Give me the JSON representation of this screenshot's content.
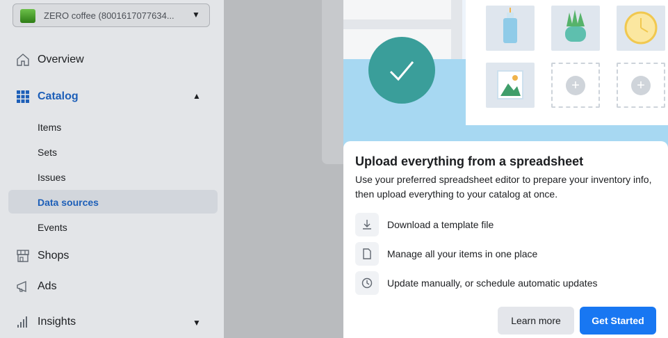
{
  "sidebar": {
    "account": {
      "name": "ZERO coffee (8001617077634...",
      "caret": "▼"
    },
    "overview": {
      "label": "Overview",
      "icon": "home-icon"
    },
    "catalog": {
      "label": "Catalog",
      "icon": "grid-icon",
      "chevron": "▲"
    },
    "catalog_items": [
      {
        "label": "Items"
      },
      {
        "label": "Sets"
      },
      {
        "label": "Issues"
      },
      {
        "label": "Data sources",
        "active": true
      },
      {
        "label": "Events"
      }
    ],
    "shops": {
      "label": "Shops",
      "icon": "store-icon"
    },
    "ads": {
      "label": "Ads",
      "icon": "megaphone-icon"
    },
    "insights": {
      "label": "Insights",
      "icon": "bar-chart-icon",
      "chevron": "▼"
    }
  },
  "modal": {
    "title": "Upload everything from a spreadsheet",
    "description": "Use your preferred spreadsheet editor to prepare your inventory info, then upload everything to your catalog at once.",
    "features": [
      {
        "label": "Download a template file",
        "icon": "download-icon"
      },
      {
        "label": "Manage all your items in one place",
        "icon": "document-icon"
      },
      {
        "label": "Update manually, or schedule automatic updates",
        "icon": "clock-icon"
      }
    ],
    "buttons": {
      "learn_more": "Learn more",
      "get_started": "Get Started"
    }
  },
  "colors": {
    "primary": "#1877f2",
    "active_nav": "#1d5fb8",
    "check": "#3a9e9a"
  }
}
